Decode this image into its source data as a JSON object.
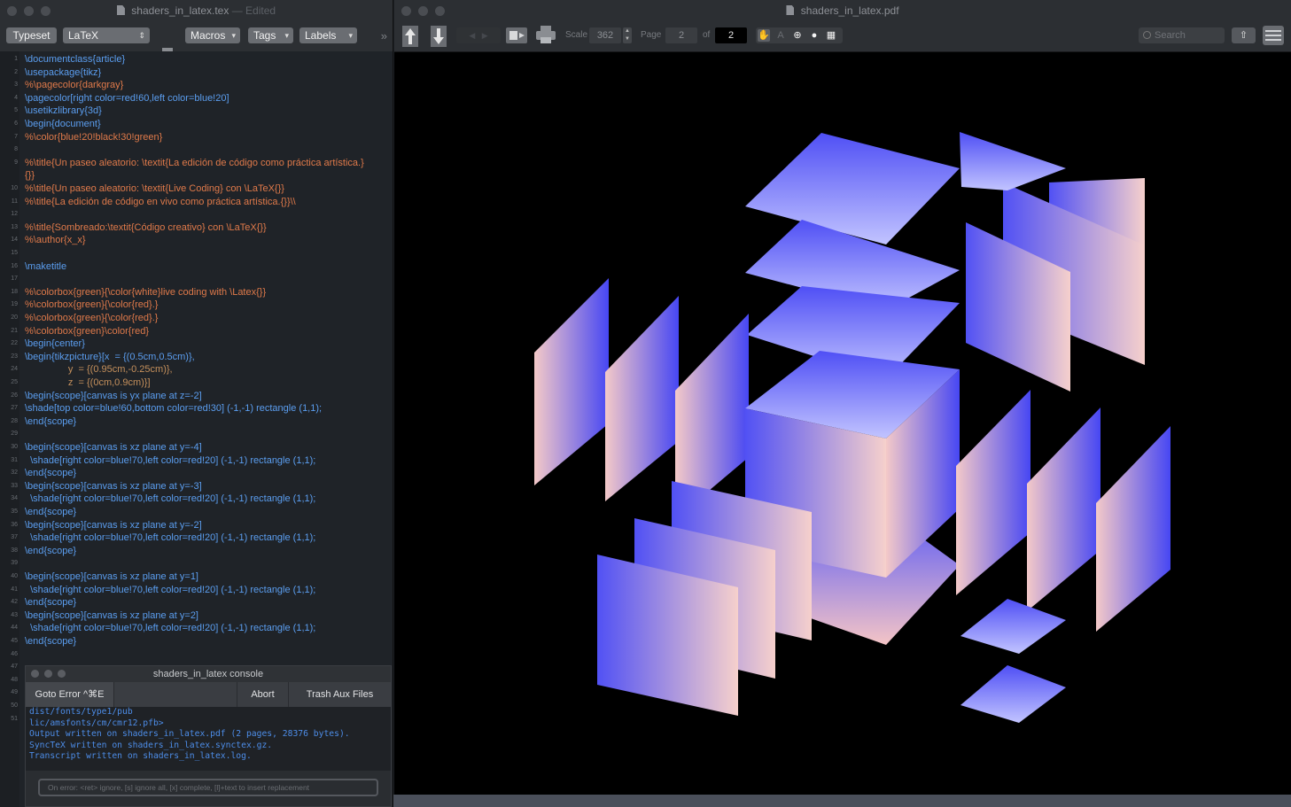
{
  "editor": {
    "title": "shaders_in_latex.tex",
    "edited": "— Edited",
    "toolbar": {
      "typeset": "Typeset",
      "engine": "LaTeX",
      "macros": "Macros",
      "tags": "Tags",
      "labels": "Labels",
      "overflow": "»"
    },
    "lines": [
      {
        "n": "1",
        "t": "\\documentclass{article}",
        "k": "cmd"
      },
      {
        "n": "2",
        "t": "\\usepackage{tikz}",
        "k": "cmd"
      },
      {
        "n": "3",
        "t": "%\\pagecolor{darkgray}",
        "k": "com"
      },
      {
        "n": "4",
        "t": "\\pagecolor[right color=red!60,left color=blue!20]",
        "k": "cmd"
      },
      {
        "n": "5",
        "t": "\\usetikzlibrary{3d}",
        "k": "cmd"
      },
      {
        "n": "6",
        "t": "\\begin{document}",
        "k": "cmd"
      },
      {
        "n": "7",
        "t": "%\\color{blue!20!black!30!green}",
        "k": "com"
      },
      {
        "n": "8",
        "t": "",
        "k": "plain"
      },
      {
        "n": "9",
        "t": "%\\title{Un paseo aleatorio: \\textit{La edición de código como práctica artística.}",
        "k": "com"
      },
      {
        "n": "",
        "t": "{}}",
        "k": "com"
      },
      {
        "n": "10",
        "t": "%\\title{Un paseo aleatorio: \\textit{Live Coding} con \\LaTeX{}}",
        "k": "com"
      },
      {
        "n": "11",
        "t": "%\\title{La edición de código en vivo como práctica artística.{}}\\\\",
        "k": "com"
      },
      {
        "n": "12",
        "t": "",
        "k": "plain"
      },
      {
        "n": "13",
        "t": "%\\title{Sombreado:\\textit{Código creativo} con \\LaTeX{}}",
        "k": "com"
      },
      {
        "n": "14",
        "t": "%\\author{x_x}",
        "k": "com"
      },
      {
        "n": "15",
        "t": "",
        "k": "plain"
      },
      {
        "n": "16",
        "t": "\\maketitle",
        "k": "cmd"
      },
      {
        "n": "17",
        "t": "",
        "k": "plain"
      },
      {
        "n": "18",
        "t": "%\\colorbox{green}{\\color{white}live coding with \\Latex{}}",
        "k": "com"
      },
      {
        "n": "19",
        "t": "%\\colorbox{green}{\\color{red}.}",
        "k": "com"
      },
      {
        "n": "20",
        "t": "%\\colorbox{green}{\\color{red}.}",
        "k": "com"
      },
      {
        "n": "21",
        "t": "%\\colorbox{green}\\color{red}",
        "k": "com"
      },
      {
        "n": "22",
        "t": "\\begin{center}",
        "k": "cmd"
      },
      {
        "n": "23",
        "t": "\\begin{tikzpicture}[x  = {(0.5cm,0.5cm)},",
        "k": "cmd"
      },
      {
        "n": "24",
        "t": "                y  = {(0.95cm,-0.25cm)},",
        "k": "arg"
      },
      {
        "n": "25",
        "t": "                z  = {(0cm,0.9cm)}]",
        "k": "arg"
      },
      {
        "n": "26",
        "t": "\\begin{scope}[canvas is yx plane at z=-2]",
        "k": "cmd"
      },
      {
        "n": "27",
        "t": "\\shade[top color=blue!60,bottom color=red!30] (-1,-1) rectangle (1,1);",
        "k": "cmd"
      },
      {
        "n": "28",
        "t": "\\end{scope}",
        "k": "cmd"
      },
      {
        "n": "29",
        "t": "",
        "k": "plain"
      },
      {
        "n": "30",
        "t": "\\begin{scope}[canvas is xz plane at y=-4]",
        "k": "cmd"
      },
      {
        "n": "31",
        "t": "  \\shade[right color=blue!70,left color=red!20] (-1,-1) rectangle (1,1);",
        "k": "cmd"
      },
      {
        "n": "32",
        "t": "\\end{scope}",
        "k": "cmd"
      },
      {
        "n": "33",
        "t": "\\begin{scope}[canvas is xz plane at y=-3]",
        "k": "cmd"
      },
      {
        "n": "34",
        "t": "  \\shade[right color=blue!70,left color=red!20] (-1,-1) rectangle (1,1);",
        "k": "cmd"
      },
      {
        "n": "35",
        "t": "\\end{scope}",
        "k": "cmd"
      },
      {
        "n": "36",
        "t": "\\begin{scope}[canvas is xz plane at y=-2]",
        "k": "cmd"
      },
      {
        "n": "37",
        "t": "  \\shade[right color=blue!70,left color=red!20] (-1,-1) rectangle (1,1);",
        "k": "cmd"
      },
      {
        "n": "38",
        "t": "\\end{scope}",
        "k": "cmd"
      },
      {
        "n": "39",
        "t": "",
        "k": "plain"
      },
      {
        "n": "40",
        "t": "\\begin{scope}[canvas is xz plane at y=1]",
        "k": "cmd"
      },
      {
        "n": "41",
        "t": "  \\shade[right color=blue!70,left color=red!20] (-1,-1) rectangle (1,1);",
        "k": "cmd"
      },
      {
        "n": "42",
        "t": "\\end{scope}",
        "k": "cmd"
      },
      {
        "n": "43",
        "t": "\\begin{scope}[canvas is xz plane at y=2]",
        "k": "cmd"
      },
      {
        "n": "44",
        "t": "  \\shade[right color=blue!70,left color=red!20] (-1,-1) rectangle (1,1);",
        "k": "cmd"
      },
      {
        "n": "45",
        "t": "\\end{scope}",
        "k": "cmd"
      },
      {
        "n": "46",
        "t": "",
        "k": "plain"
      },
      {
        "n": "47",
        "t": "",
        "k": "plain"
      },
      {
        "n": "48",
        "t": "",
        "k": "plain"
      },
      {
        "n": "49",
        "t": "",
        "k": "plain"
      },
      {
        "n": "50",
        "t": "",
        "k": "plain"
      },
      {
        "n": "51",
        "t": "",
        "k": "plain"
      }
    ]
  },
  "console": {
    "title": "shaders_in_latex console",
    "goto_error": "Goto Error ^⌘E",
    "abort": "Abort",
    "trash": "Trash Aux Files",
    "log": "dist/fonts/type1/pub\nlic/amsfonts/cm/cmr12.pfb>\nOutput written on shaders_in_latex.pdf (2 pages, 28376 bytes).\nSyncTeX written on shaders_in_latex.synctex.gz.\nTranscript written on shaders_in_latex.log.",
    "input_placeholder": "On error: <ret> ignore, [s] ignore all, [x] complete, [l]+text to insert replacement"
  },
  "viewer": {
    "title": "shaders_in_latex.pdf",
    "scale_label": "Scale",
    "scale_value": "362",
    "page_label": "Page",
    "page_value": "2",
    "of_label": "of",
    "total_pages": "2",
    "search_placeholder": "Search",
    "tool_icons": [
      "hand-tool-icon",
      "text-select-icon",
      "magnify-tool-icon",
      "zoom-tool-icon",
      "select-tool-icon"
    ]
  },
  "colors": {
    "blue": "#4a4af5",
    "light_blue": "#b3b6ff",
    "pink": "#f5cfcc",
    "comment": "#e07a4a",
    "command": "#5b9ef0"
  }
}
